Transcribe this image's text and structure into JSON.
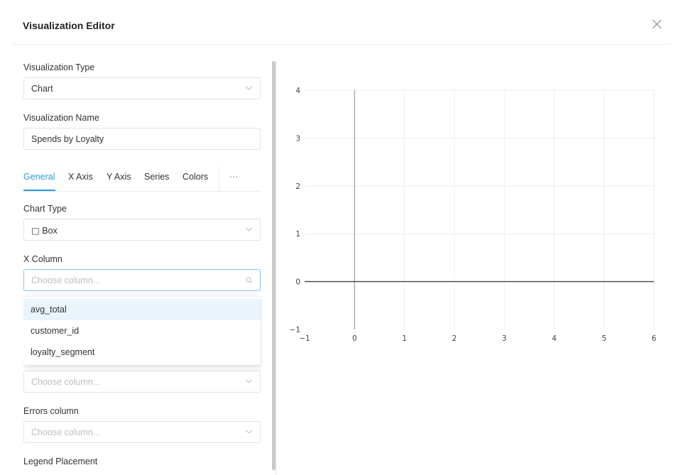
{
  "dialog": {
    "title": "Visualization Editor",
    "close_icon": "close-icon"
  },
  "editor": {
    "viz_type": {
      "label": "Visualization Type",
      "value": "Chart"
    },
    "viz_name": {
      "label": "Visualization Name",
      "value": "Spends by Loyalty"
    },
    "tabs": [
      "General",
      "X Axis",
      "Y Axis",
      "Series",
      "Colors",
      "···"
    ],
    "active_tab": "General",
    "chart_type": {
      "label": "Chart Type",
      "value": "▢ Box"
    },
    "x_column": {
      "label": "X Column",
      "placeholder": "Choose column..."
    },
    "x_column_options": [
      "avg_total",
      "customer_id",
      "loyalty_segment"
    ],
    "hidden_select": {
      "placeholder": "Choose column..."
    },
    "errors_column": {
      "label": "Errors column",
      "placeholder": "Choose column..."
    },
    "legend_placement": {
      "label": "Legend Placement"
    }
  },
  "chart_data": {
    "type": "box",
    "x_ticks": [
      "−1",
      "0",
      "1",
      "2",
      "3",
      "4",
      "5",
      "6"
    ],
    "y_ticks": [
      "−1",
      "0",
      "1",
      "2",
      "3",
      "4"
    ],
    "xlim": [
      -1,
      6
    ],
    "ylim": [
      -1,
      4
    ],
    "series": [],
    "grid": true,
    "colors": {
      "grid": "#eeeeee",
      "zero_line": "#444444",
      "accent": "#2d9ce4"
    }
  }
}
